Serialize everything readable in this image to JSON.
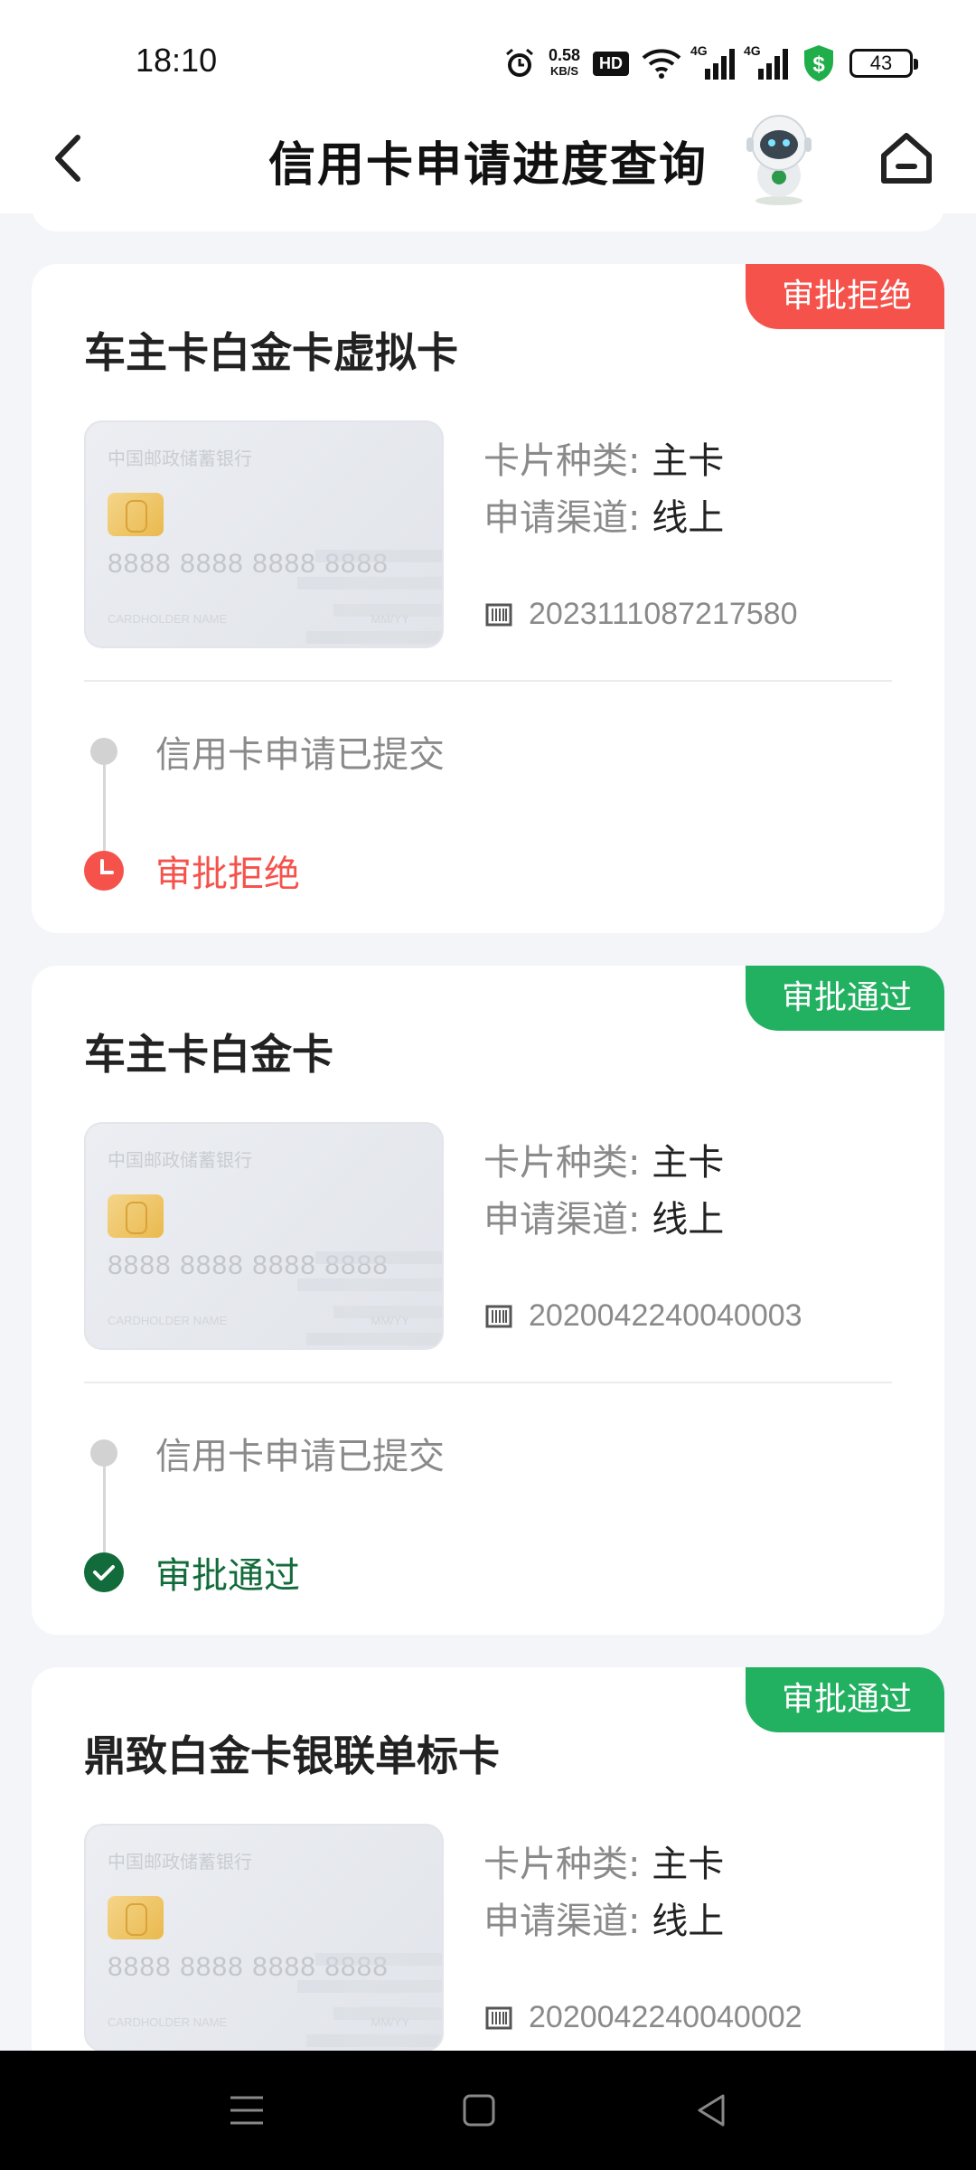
{
  "status_bar": {
    "time": "18:10",
    "speed_value": "0.58",
    "speed_unit": "KB/S",
    "hd": "HD",
    "sig1_label": "4G",
    "sig2_label": "4G",
    "battery": "43"
  },
  "nav": {
    "title": "信用卡申请进度查询"
  },
  "labels": {
    "card_type_key": "卡片种类:",
    "channel_key": "申请渠道:",
    "step_submitted": "信用卡申请已提交"
  },
  "card_face": {
    "bank": "中国邮政储蓄银行",
    "number": "8888 8888 8888 8888",
    "holder": "CARDHOLDER NAME",
    "expiry": "MM/YY"
  },
  "cards": [
    {
      "title": "车主卡白金卡虚拟卡",
      "badge": "审批拒绝",
      "status_color": "#f5524b",
      "card_type": "主卡",
      "channel": "线上",
      "serial": "2023111087217580",
      "final_step": "审批拒绝"
    },
    {
      "title": "车主卡白金卡",
      "badge": "审批通过",
      "status_color": "#22b061",
      "card_type": "主卡",
      "channel": "线上",
      "serial": "2020042240040003",
      "final_step": "审批通过"
    },
    {
      "title": "鼎致白金卡银联单标卡",
      "badge": "审批通过",
      "status_color": "#22b061",
      "card_type": "主卡",
      "channel": "线上",
      "serial": "2020042240040002"
    }
  ]
}
